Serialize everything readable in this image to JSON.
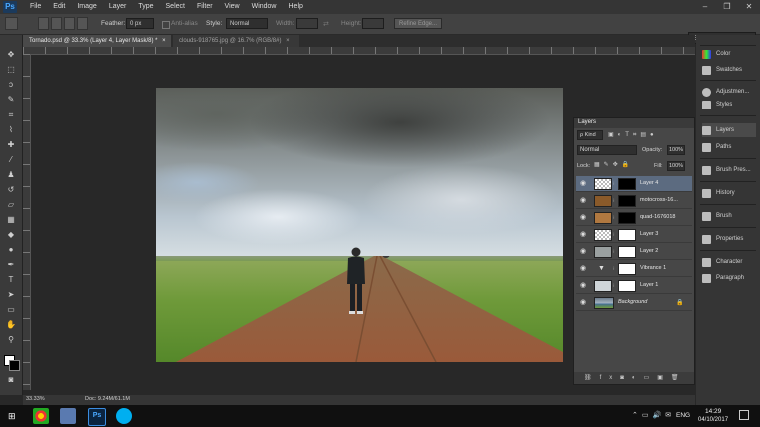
{
  "app": {
    "logo": "Ps"
  },
  "menu": [
    "File",
    "Edit",
    "Image",
    "Layer",
    "Type",
    "Select",
    "Filter",
    "View",
    "Window",
    "Help"
  ],
  "window_controls": {
    "minimize": "–",
    "restore": "❐",
    "close": "✕"
  },
  "options": {
    "feather_label": "Feather:",
    "feather_value": "0 px",
    "antialias_label": "Anti-alias",
    "style_label": "Style:",
    "style_value": "Normal",
    "width_label": "Width:",
    "height_label": "Height:",
    "refine_label": "Refine Edge..."
  },
  "workspace_select": "Essentials",
  "tabs": [
    {
      "label": "Tornado.psd @ 33.3% (Layer 4, Layer Mask/8) *",
      "close": "×"
    },
    {
      "label": "clouds-918765.jpg @ 16.7% (RGB/8#)",
      "close": "×"
    }
  ],
  "right_strip": {
    "top": [
      {
        "label": "Color",
        "icon": "color-icon"
      },
      {
        "label": "Swatches",
        "icon": "swatches-icon"
      }
    ],
    "mid": [
      {
        "label": "Adjustmen...",
        "icon": "adjustments-icon"
      },
      {
        "label": "Styles",
        "icon": "styles-icon"
      }
    ],
    "groups": [
      {
        "label": "Layers",
        "icon": "layers-icon"
      },
      {
        "label": "Paths",
        "icon": "paths-icon"
      },
      {
        "label": "Brush Pres...",
        "icon": "brush-presets-icon"
      },
      {
        "label": "History",
        "icon": "history-icon"
      },
      {
        "label": "Brush",
        "icon": "brush-icon"
      },
      {
        "label": "Properties",
        "icon": "properties-icon"
      },
      {
        "label": "Character",
        "icon": "character-icon"
      },
      {
        "label": "Paragraph",
        "icon": "paragraph-icon"
      }
    ]
  },
  "layers_panel": {
    "title": "Layers",
    "kind_label": "ρ Kind",
    "blend_mode": "Normal",
    "opacity_label": "Opacity:",
    "opacity_value": "100%",
    "lock_label": "Lock:",
    "fill_label": "Fill:",
    "fill_value": "100%",
    "layers": [
      {
        "name": "Layer 4",
        "selected": true
      },
      {
        "name": "motocross-16...",
        "selected": false
      },
      {
        "name": "quad-1676018",
        "selected": false
      },
      {
        "name": "Layer 3",
        "selected": false
      },
      {
        "name": "Layer 2",
        "selected": false
      },
      {
        "name": "Vibrance 1",
        "selected": false
      },
      {
        "name": "Layer 1",
        "selected": false
      },
      {
        "name": "Background",
        "selected": false
      }
    ]
  },
  "status": {
    "zoom": "33.33%",
    "doc": "Doc: 9.24M/61.1M"
  },
  "taskbar": {
    "lang": "ENG",
    "time": "14:29",
    "date": "04/10/2017"
  }
}
